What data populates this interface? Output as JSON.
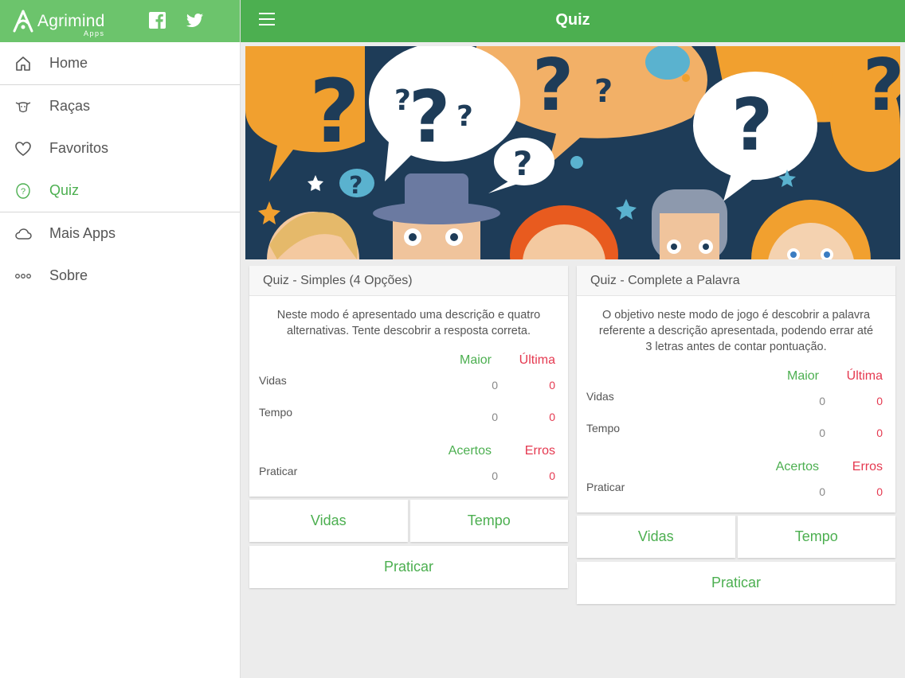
{
  "brand": {
    "name": "Agrimind",
    "sub": "Apps"
  },
  "social": {
    "facebook_icon": "facebook-icon",
    "twitter_icon": "twitter-icon"
  },
  "header": {
    "title": "Quiz"
  },
  "sidebar": {
    "items": [
      {
        "label": "Home",
        "icon": "home-icon"
      },
      {
        "label": "Raças",
        "icon": "cow-icon"
      },
      {
        "label": "Favoritos",
        "icon": "heart-icon"
      },
      {
        "label": "Quiz",
        "icon": "question-icon",
        "active": true
      },
      {
        "label": "Mais Apps",
        "icon": "cloud-icon"
      },
      {
        "label": "Sobre",
        "icon": "dots-icon"
      }
    ]
  },
  "colors": {
    "topbar": "#4caf50",
    "sidebar_header": "#6cc46c",
    "accent_green": "#4caf50",
    "accent_red": "#e53950"
  },
  "cards": [
    {
      "title": "Quiz - Simples (4 Opções)",
      "description": "Neste modo é apresentado uma descrição e quatro alternativas. Tente descobrir a resposta correta.",
      "headers1": {
        "best": "Maior",
        "last": "Última"
      },
      "rows1": [
        {
          "label": "Vidas",
          "best": "0",
          "last": "0"
        },
        {
          "label": "Tempo",
          "best": "0",
          "last": "0"
        }
      ],
      "headers2": {
        "hits": "Acertos",
        "errors": "Erros"
      },
      "rows2": [
        {
          "label": "Praticar",
          "hits": "0",
          "errors": "0"
        }
      ],
      "buttons": {
        "vidas": "Vidas",
        "tempo": "Tempo",
        "praticar": "Praticar"
      }
    },
    {
      "title": "Quiz - Complete a Palavra",
      "description": "O objetivo neste modo de jogo é descobrir a palavra referente a descrição apresentada, podendo errar até 3 letras antes de contar pontuação.",
      "headers1": {
        "best": "Maior",
        "last": "Última"
      },
      "rows1": [
        {
          "label": "Vidas",
          "best": "0",
          "last": "0"
        },
        {
          "label": "Tempo",
          "best": "0",
          "last": "0"
        }
      ],
      "headers2": {
        "hits": "Acertos",
        "errors": "Erros"
      },
      "rows2": [
        {
          "label": "Praticar",
          "hits": "0",
          "errors": "0"
        }
      ],
      "buttons": {
        "vidas": "Vidas",
        "tempo": "Tempo",
        "praticar": "Praticar"
      }
    }
  ]
}
